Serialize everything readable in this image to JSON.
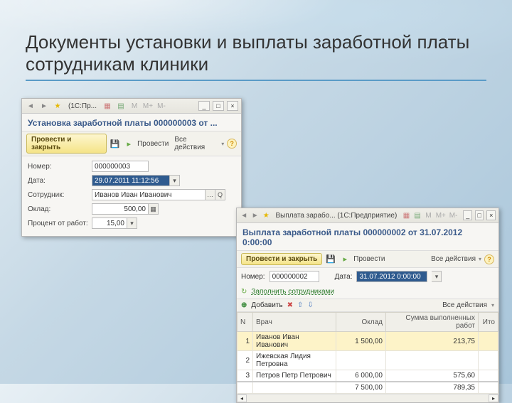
{
  "slide": {
    "title": "Документы установки и выплаты заработной платы сотрудникам клиники"
  },
  "win1": {
    "titlebar_text": "(1С:Пр...",
    "doc_title": "Установка заработной платы 000000003 от ...",
    "btn_main": "Провести и закрыть",
    "btn_provesti": "Провести",
    "all_actions": "Все действия",
    "labels": {
      "number": "Номер:",
      "date": "Дата:",
      "employee": "Сотрудник:",
      "salary": "Оклад:",
      "percent": "Процент от работ:"
    },
    "values": {
      "number": "000000003",
      "date": "29.07.2011 11:12:56",
      "employee": "Иванов Иван Иванович",
      "salary": "500,00",
      "percent": "15,00"
    }
  },
  "win2": {
    "titlebar_text": "Выплата зарабо...  (1С:Предприятие)",
    "doc_title": "Выплата заработной платы 000000002 от 31.07.2012 0:00:00",
    "btn_main": "Провести и закрыть",
    "btn_provesti": "Провести",
    "all_actions": "Все действия",
    "labels": {
      "number": "Номер:",
      "date": "Дата:"
    },
    "values": {
      "number": "000000002",
      "date": "31.07.2012 0:00:00"
    },
    "fill_link": "Заполнить сотрудниками",
    "add_btn": "Добавить",
    "columns": {
      "n": "N",
      "emp": "Врач",
      "salary": "Оклад",
      "work_sum": "Сумма выполненных работ",
      "total": "Ито"
    },
    "rows": [
      {
        "n": "1",
        "emp": "Иванов Иван Иванович",
        "salary": "1 500,00",
        "work_sum": "213,75"
      },
      {
        "n": "2",
        "emp": "Ижевская Лидия Петровна",
        "salary": "",
        "work_sum": ""
      },
      {
        "n": "3",
        "emp": "Петров Петр Петрович",
        "salary": "6 000,00",
        "work_sum": "575,60"
      }
    ],
    "totals": {
      "salary": "7 500,00",
      "work_sum": "789,35"
    }
  }
}
